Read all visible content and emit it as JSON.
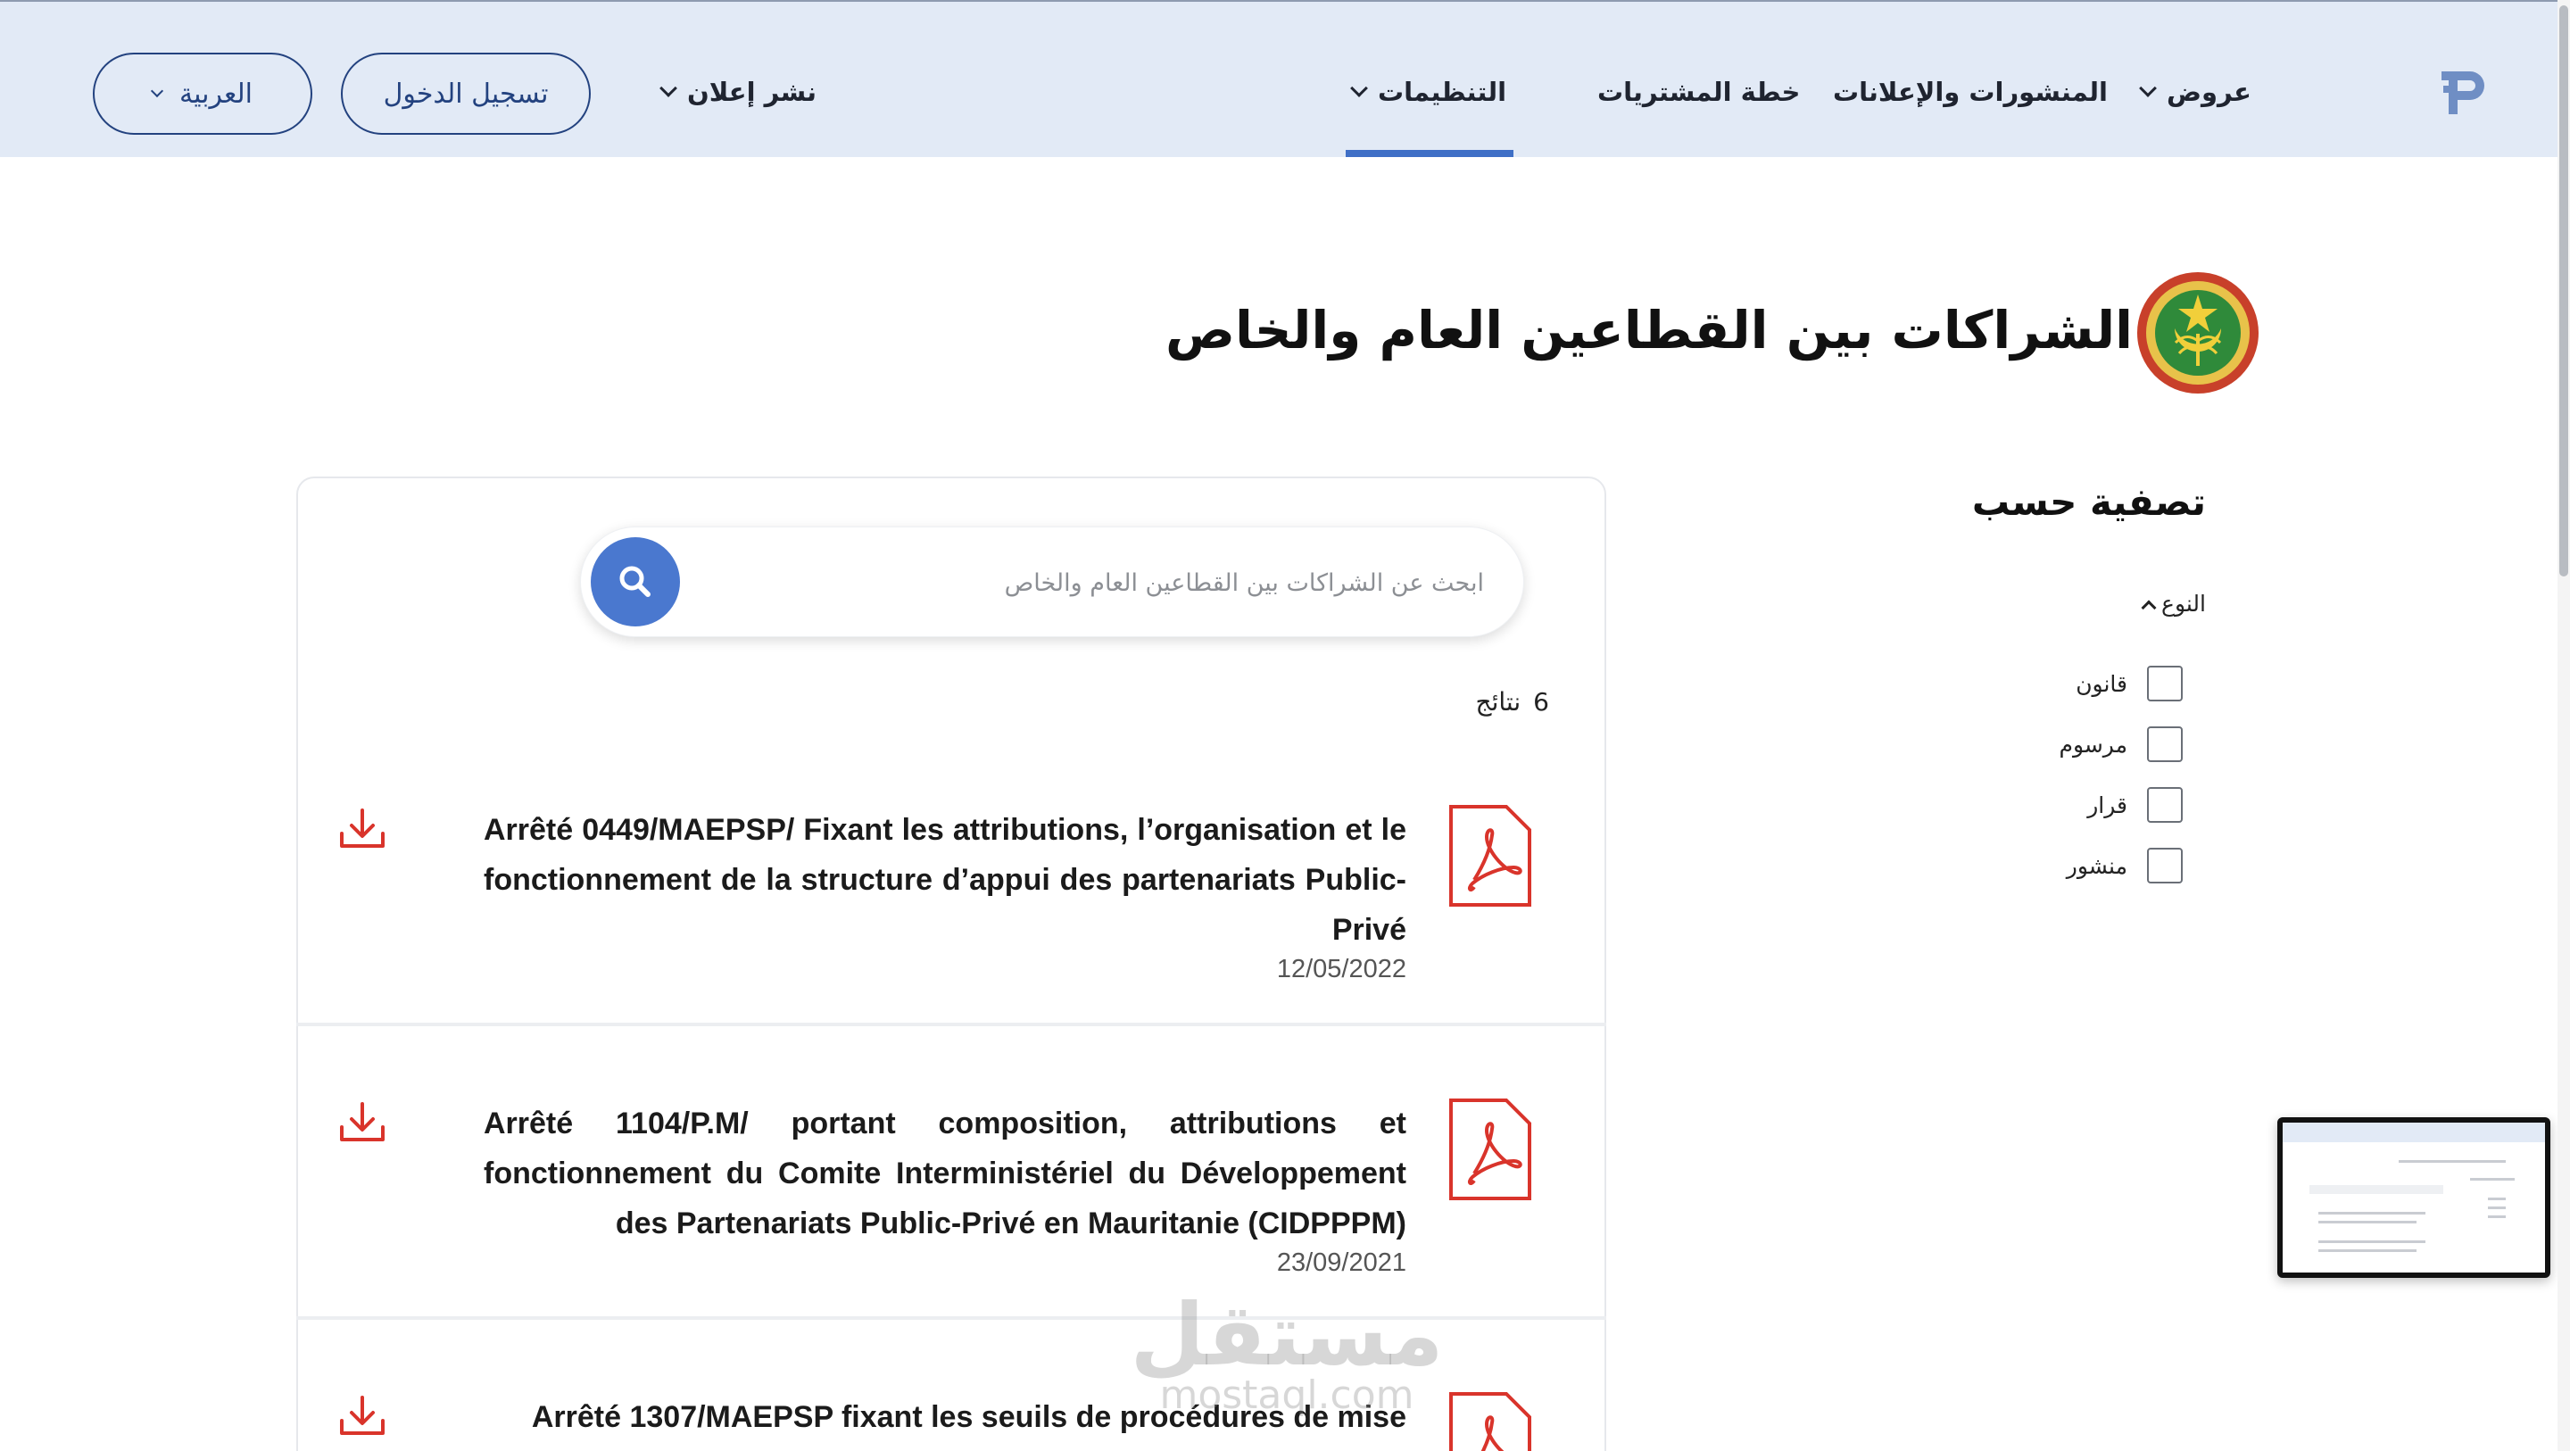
{
  "header": {
    "nav": {
      "offers": "عروض",
      "publications": "المنشورات والإعلانات",
      "procurement_plan": "خطة المشتريات",
      "regulations": "التنظيمات",
      "publish_ad": "نشر إعلان"
    },
    "login_label": "تسجيل الدخول",
    "language_label": "العربية",
    "active_tab": "التنظيمات"
  },
  "page": {
    "title": "الشراكات بين القطاعين العام والخاص",
    "emblem_text": "RÉPUBLIQUE ISLAMIQUE DE MAURITANIE"
  },
  "filters": {
    "title": "تصفية حسب",
    "group_label": "النوع",
    "options": [
      "قانون",
      "مرسوم",
      "قرار",
      "منشور"
    ]
  },
  "search": {
    "placeholder": "ابحث عن الشراكات بين القطاعين العام والخاص",
    "value": ""
  },
  "results": {
    "count": "6",
    "count_label": "نتائج",
    "items": [
      {
        "title": "Arrêté 0449/MAEPSP/ Fixant les attributions, l’organisation et le fonctionnement de la structure d’appui des partenariats Public-Privé",
        "date": "12/05/2022"
      },
      {
        "title": "Arrêté 1104/P.M/ portant composition, attributions et fonctionnement du Comite Interministériel du Développement des Partenariats Public-Privé en Mauritanie (CIDPPPM)",
        "date": "23/09/2021"
      },
      {
        "title": "Arrêté 1307/MAEPSP fixant les seuils de procédures de mise",
        "date": ""
      }
    ]
  },
  "watermark": {
    "arabic": "مستقل",
    "latin": "mostaql.com"
  },
  "colors": {
    "header_bg": "#e2eaf6",
    "accent": "#3f6fc6",
    "search_button": "#4a78cf",
    "pdf_red": "#d9342b",
    "pill_border": "#23427f"
  },
  "icons": {
    "logo": "p-logo-icon",
    "search": "search-icon",
    "pdf": "pdf-file-icon",
    "download": "download-icon",
    "chevron": "chevron-down-icon"
  }
}
